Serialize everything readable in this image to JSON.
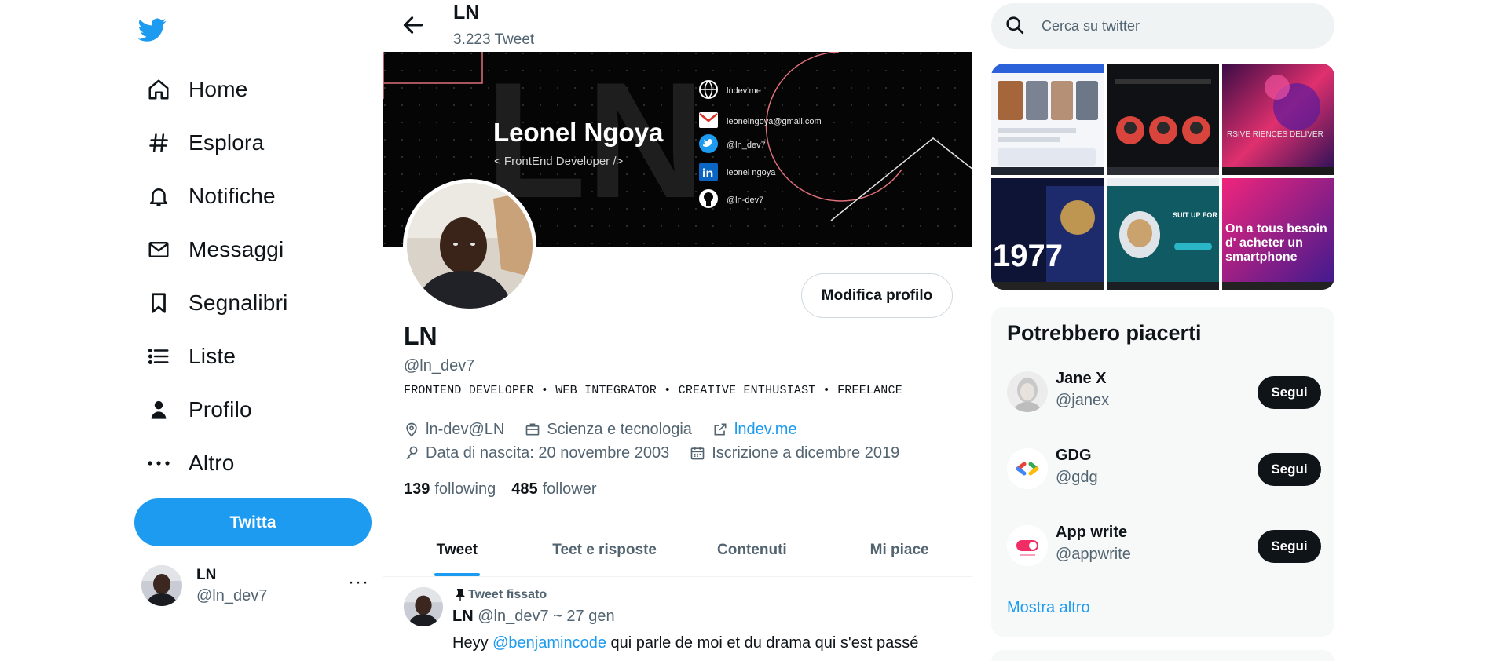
{
  "sidebar": {
    "nav": [
      {
        "label": "Home",
        "icon": "home-icon"
      },
      {
        "label": "Esplora",
        "icon": "hashtag-icon"
      },
      {
        "label": "Notifiche",
        "icon": "bell-icon"
      },
      {
        "label": "Messaggi",
        "icon": "mail-icon"
      },
      {
        "label": "Segnalibri",
        "icon": "bookmark-icon"
      },
      {
        "label": "Liste",
        "icon": "list-icon"
      },
      {
        "label": "Profilo",
        "icon": "person-icon"
      },
      {
        "label": "Altro",
        "icon": "more-icon"
      }
    ],
    "tweet_button": "Twitta",
    "account": {
      "name": "LN",
      "handle": "@ln_dev7",
      "more": "···"
    }
  },
  "header": {
    "name": "LN",
    "tweet_count": "3.223 Tweet"
  },
  "banner": {
    "name": "Leonel Ngoya",
    "role": "< FrontEnd  Developer />",
    "links": [
      "lndev.me",
      "leonelngoya@gmail.com",
      "@ln_dev7",
      "leonel ngoya",
      "@ln-dev7"
    ]
  },
  "profile": {
    "edit_button": "Modifica profilo",
    "name": "LN",
    "handle": "@ln_dev7",
    "bio": "FRONTEND DEVELOPER • WEB INTEGRATOR • CREATIVE ENTHUSIAST • FREELANCE",
    "location": "ln-dev@LN",
    "category": "Scienza e tecnologia",
    "website": "lndev.me",
    "birth": "Data di nascita: 20 novembre 2003",
    "joined": "Iscrizione a dicembre 2019",
    "following_count": "139",
    "following_label": "following",
    "followers_count": "485",
    "followers_label": "follower"
  },
  "tabs": [
    {
      "label": "Tweet",
      "active": true
    },
    {
      "label": "Teet e risposte",
      "active": false
    },
    {
      "label": "Contenuti",
      "active": false
    },
    {
      "label": "Mi piace",
      "active": false
    }
  ],
  "pinned_post": {
    "pinned_label": "Tweet fissato",
    "author": "LN",
    "meta": "@ln_dev7 ~ 27 gen",
    "text_before": "Heyy ",
    "mention": "@benjamincode",
    "text_after": " qui parle de moi et du drama qui s'est passé"
  },
  "search": {
    "placeholder": "Cerca su twitter"
  },
  "media_thumbs": [
    {
      "text": ""
    },
    {
      "text": ""
    },
    {
      "text": "RSIVE RIENCES DELIVER"
    },
    {
      "text": "1977"
    },
    {
      "text": "SUIT UP FOR THE JOURNEY !"
    },
    {
      "text": "On a tous besoin d' acheter un smartphone"
    }
  ],
  "suggestions": {
    "title": "Potrebbero piacerti",
    "items": [
      {
        "name": "Jane X",
        "handle": "@janex",
        "button": "Segui"
      },
      {
        "name": "GDG",
        "handle": "@gdg",
        "button": "Segui"
      },
      {
        "name": "App write",
        "handle": "@appwrite",
        "button": "Segui"
      }
    ],
    "more": "Mostra altro"
  },
  "colors": {
    "accent": "#1d9bf0",
    "text": "#0f1419",
    "muted": "#536471",
    "surface": "#f7f9f9"
  }
}
